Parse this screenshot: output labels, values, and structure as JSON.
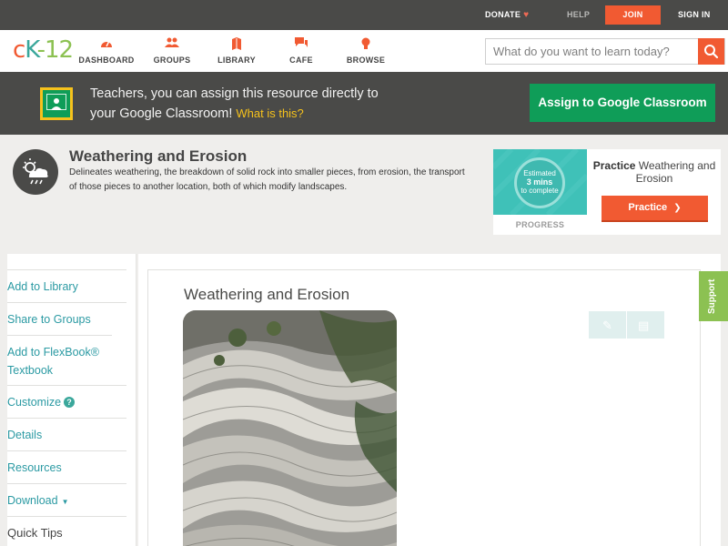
{
  "topbar": {
    "donate": "DONATE",
    "help": "HELP",
    "join": "JOIN",
    "signin": "SIGN IN"
  },
  "logo": {
    "c": "c",
    "k": "K",
    "n": "-12"
  },
  "nav": [
    {
      "label": "DASHBOARD",
      "icon": "gauge-icon"
    },
    {
      "label": "GROUPS",
      "icon": "users-icon"
    },
    {
      "label": "LIBRARY",
      "icon": "book-icon"
    },
    {
      "label": "CAFE",
      "icon": "chat-icon"
    },
    {
      "label": "BROWSE",
      "icon": "lightbulb-icon"
    }
  ],
  "search": {
    "placeholder": "What do you want to learn today?"
  },
  "classroom": {
    "line1": "Teachers, you can assign this resource directly to",
    "line2": "your Google Classroom!",
    "what": "What is this?",
    "button": "Assign to Google Classroom"
  },
  "concept": {
    "title": "Weathering and Erosion",
    "description": "Delineates weathering, the breakdown of solid rock into smaller pieces, from erosion, the transport of those pieces to another location, both of which modify landscapes."
  },
  "practice": {
    "estimated": "Estimated",
    "mins": "3 mins",
    "to_complete": "to complete",
    "progress": "PROGRESS",
    "title_bold": "Practice",
    "title_rest": " Weathering and Erosion",
    "button": "Practice"
  },
  "sidebar": {
    "items": [
      {
        "label": "Add to Library"
      },
      {
        "label": "Share to Groups"
      },
      {
        "label": "Add to FlexBook® Textbook"
      },
      {
        "label": "Customize"
      },
      {
        "label": "Details"
      },
      {
        "label": "Resources"
      },
      {
        "label": "Download"
      }
    ],
    "quick_tips": "Quick Tips"
  },
  "content": {
    "title": "Weathering and Erosion"
  },
  "support": "Support",
  "colors": {
    "brand_orange": "#f15a32",
    "teal": "#3aa79b",
    "google_green": "#0f9d58",
    "dark_bar": "#4a4a48",
    "support_green": "#8cc152"
  }
}
